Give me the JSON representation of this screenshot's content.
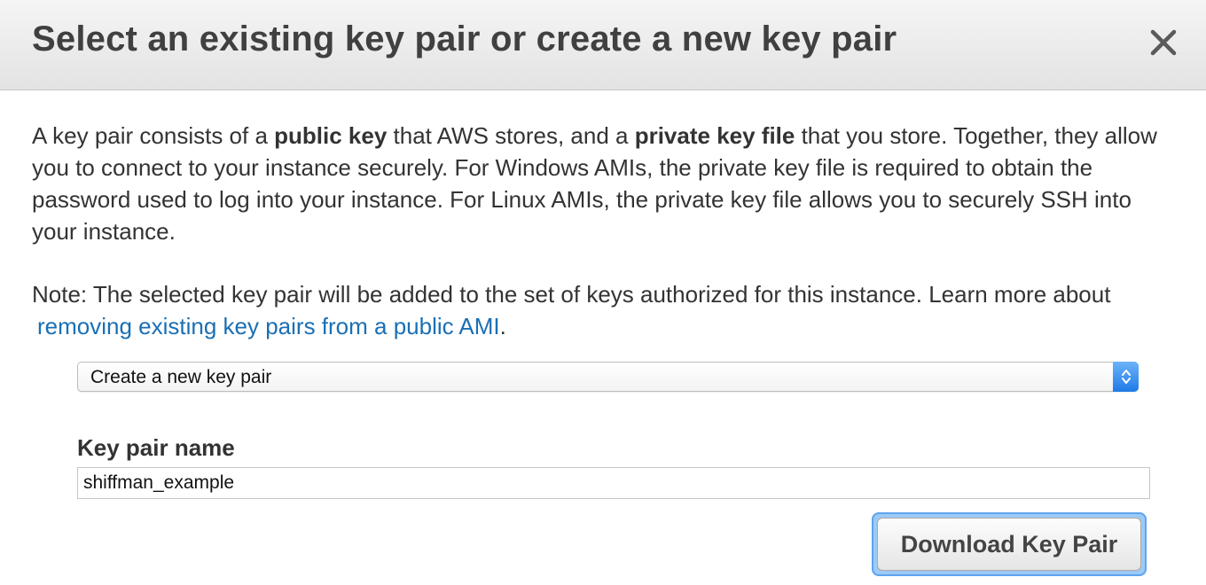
{
  "dialog": {
    "title": "Select an existing key pair or create a new key pair",
    "close_icon": "close-icon"
  },
  "intro": {
    "part1": "A key pair consists of a ",
    "bold1": "public key",
    "part2": " that AWS stores, and a ",
    "bold2": "private key file",
    "part3": " that you store. Together, they allow you to connect to your instance securely. For Windows AMIs, the private key file is required to obtain the password used to log into your instance. For Linux AMIs, the private key file allows you to securely SSH into your instance."
  },
  "note": {
    "text": "Note: The selected key pair will be added to the set of keys authorized for this instance. Learn more about",
    "link": "removing existing key pairs from a public AMI",
    "end": "."
  },
  "key_pair_select": {
    "selected": "Create a new key pair",
    "icon": "up-down-arrows-icon",
    "accent_color": "#1f7ae6"
  },
  "key_pair_name": {
    "label": "Key pair name",
    "value": "shiffman_example"
  },
  "download_button": {
    "label": "Download Key Pair",
    "focus_color": "#5ea4ee"
  },
  "colors": {
    "link": "#1a6fb4",
    "text": "#333333",
    "title": "#404040"
  }
}
